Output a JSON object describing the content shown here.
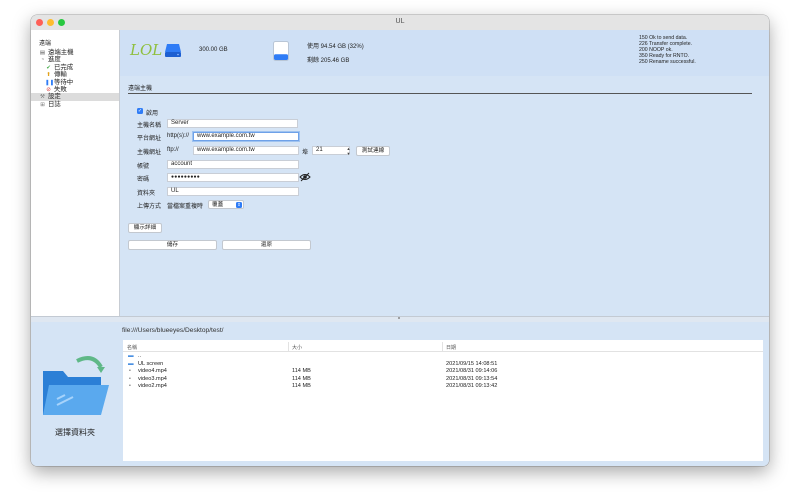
{
  "window": {
    "title": "UL"
  },
  "sidebar": {
    "header": "遠端",
    "items": [
      {
        "label": "遠端主機",
        "icon": "server-icon",
        "indent": 8
      },
      {
        "label": "進度",
        "icon": "progress-icon",
        "indent": 8
      },
      {
        "label": "已完成",
        "icon": "checkmark-icon",
        "indent": 14
      },
      {
        "label": "傳輸",
        "icon": "upload-arrow-icon",
        "indent": 14
      },
      {
        "label": "等待中",
        "icon": "pause-icon",
        "indent": 14
      },
      {
        "label": "失敗",
        "icon": "prohibited-icon",
        "indent": 14
      },
      {
        "label": "設定",
        "icon": "wrench-icon",
        "indent": 8,
        "selected": true
      },
      {
        "label": "日誌",
        "icon": "log-icon",
        "indent": 8
      }
    ]
  },
  "header": {
    "logo": "LOL",
    "capacity": "300.00 GB",
    "used": "使用 94.54 GB (32%)",
    "used_fraction": 0.32,
    "free": "剩餘 205.46 GB",
    "log_lines": [
      "150 Ok to send data.",
      "226 Transfer complete.",
      "200 NOOP ok.",
      "350 Ready for RNTO.",
      "250 Rename successful."
    ]
  },
  "settings": {
    "section_title": "遠端主機",
    "enable_label": "啟用",
    "enabled": true,
    "host_name_label": "主機名稱",
    "host_name_value": "Server",
    "platform_url_label": "平台網址",
    "platform_url_prefix": "http(s)://",
    "platform_url_value": "www.example.com.tw",
    "host_url_label": "主機網址",
    "host_url_prefix": "ftp://",
    "host_url_value": "www.example.com.tw",
    "port_label": "埠",
    "port_value": "21",
    "test_button": "測試連線",
    "account_label": "帳號",
    "account_value": "account",
    "password_label": "密碼",
    "password_value": "●●●●●●●●●",
    "folder_label": "資料夾",
    "folder_value": "UL",
    "upload_mode_label": "上傳方式",
    "upload_mode_condition": "當檔案重複時",
    "upload_mode_value": "覆蓋",
    "details_button": "顯示詳細",
    "save_button": "儲存",
    "restore_button": "還原"
  },
  "bottom": {
    "choose_folder_label": "選擇資料夾",
    "path": "file:///Users/blueeyes/Desktop/test/",
    "columns": [
      "名稱",
      "大小",
      "日期"
    ],
    "files": [
      {
        "icon": "folder-icon",
        "name": "..",
        "size": "",
        "date": ""
      },
      {
        "icon": "folder-icon",
        "name": "UL screen",
        "size": "",
        "date": "2021/09/15 14:08:51"
      },
      {
        "icon": "file-icon",
        "name": "video4.mp4",
        "size": "114 MB",
        "date": "2021/08/31 09:14:06"
      },
      {
        "icon": "file-icon",
        "name": "video3.mp4",
        "size": "114 MB",
        "date": "2021/08/31 09:13:54"
      },
      {
        "icon": "file-icon",
        "name": "video2.mp4",
        "size": "114 MB",
        "date": "2021/08/31 09:13:42"
      }
    ]
  },
  "colors": {
    "accent": "#2f7cf6",
    "logo_green": "#8fbf3f",
    "header_bg": "#cfe0f5",
    "content_bg": "#d5e4f5"
  }
}
